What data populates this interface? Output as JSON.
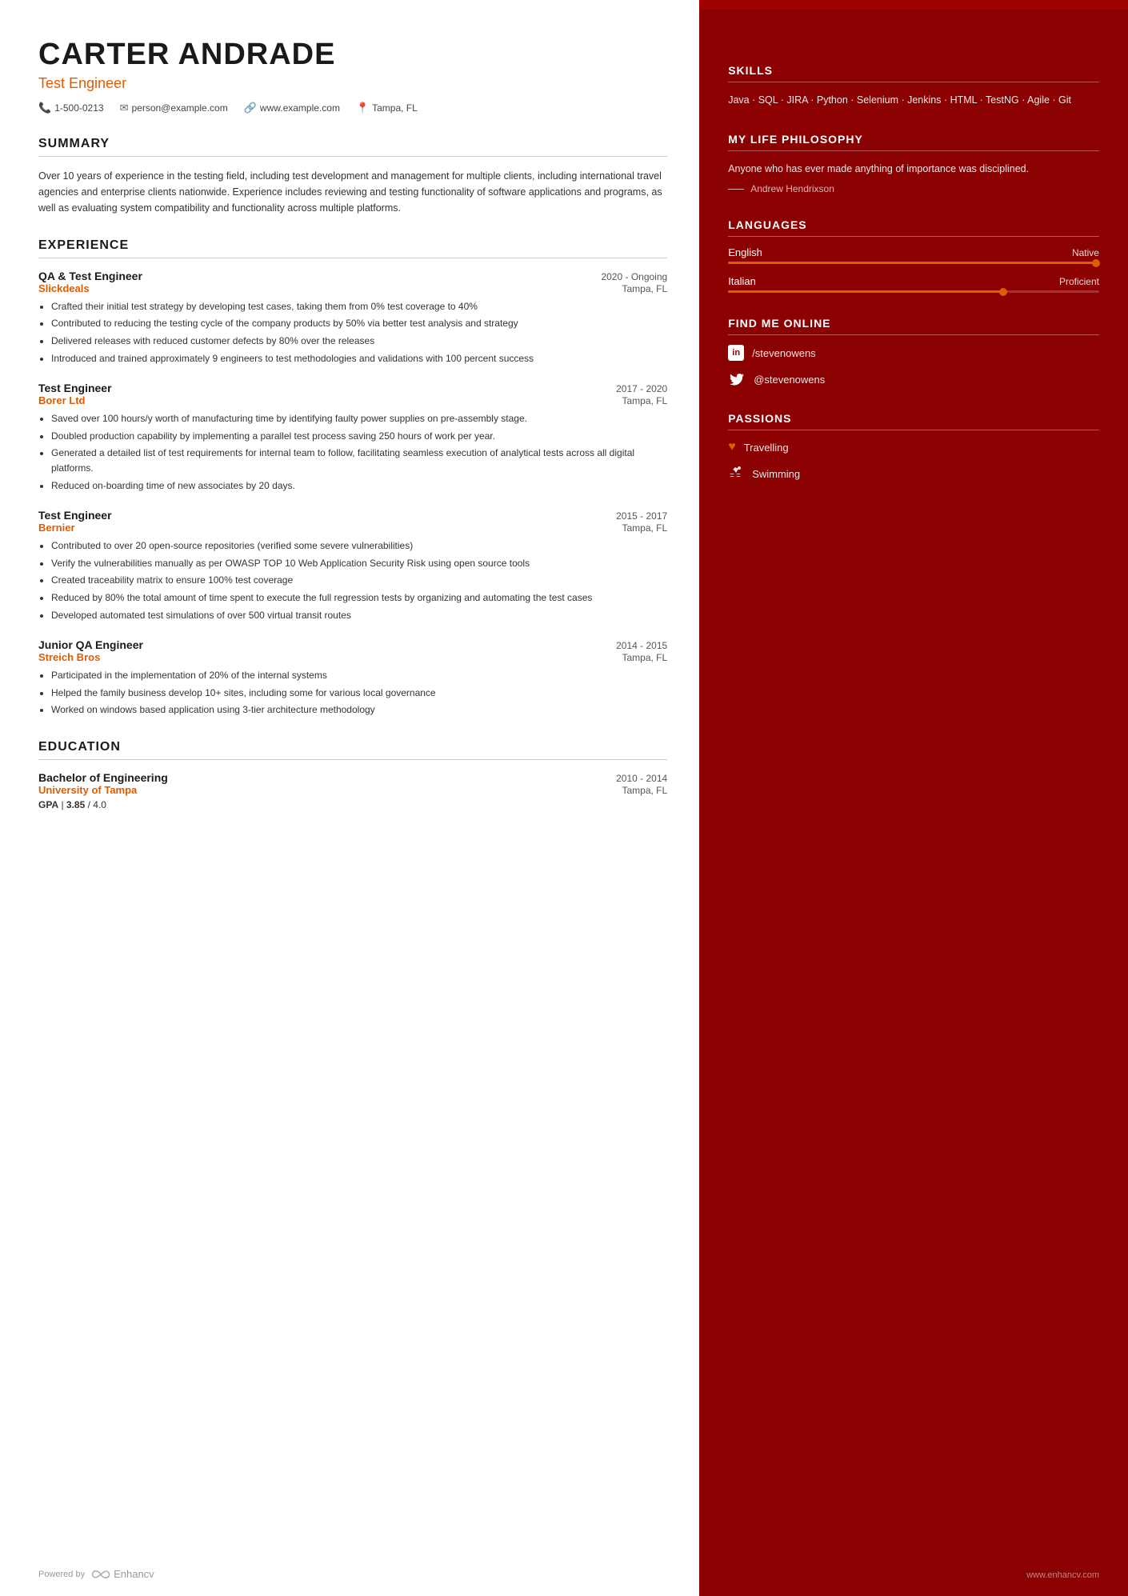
{
  "header": {
    "name": "CARTER ANDRADE",
    "title": "Test Engineer",
    "phone": "1-500-0213",
    "email": "person@example.com",
    "website": "www.example.com",
    "location": "Tampa, FL"
  },
  "summary": {
    "section_title": "SUMMARY",
    "text": "Over 10 years of experience in the testing field, including test development and management for multiple clients, including international travel agencies and enterprise clients nationwide. Experience includes reviewing and testing functionality of software applications and programs, as well as evaluating system compatibility and functionality across multiple platforms."
  },
  "experience": {
    "section_title": "EXPERIENCE",
    "jobs": [
      {
        "role": "QA & Test Engineer",
        "date": "2020 - Ongoing",
        "company": "Slickdeals",
        "location": "Tampa, FL",
        "bullets": [
          "Crafted their initial test strategy by developing test cases, taking them from 0% test coverage to 40%",
          "Contributed to reducing the testing cycle of the company products by 50% via better test analysis and strategy",
          "Delivered releases with reduced customer defects by 80% over the releases",
          "Introduced and trained approximately 9 engineers to test methodologies and validations with 100 percent success"
        ]
      },
      {
        "role": "Test Engineer",
        "date": "2017 - 2020",
        "company": "Borer Ltd",
        "location": "Tampa, FL",
        "bullets": [
          "Saved over 100 hours/y worth of manufacturing time by identifying faulty power supplies on pre-assembly stage.",
          "Doubled production capability by implementing a parallel test process saving 250 hours of work per year.",
          "Generated a detailed list of test requirements for internal team to follow, facilitating seamless execution of analytical tests across all digital platforms.",
          "Reduced on-boarding time of new associates by 20 days."
        ]
      },
      {
        "role": "Test Engineer",
        "date": "2015 - 2017",
        "company": "Bernier",
        "location": "Tampa, FL",
        "bullets": [
          "Contributed to over 20 open-source repositories (verified some severe vulnerabilities)",
          "Verify the vulnerabilities manually as per OWASP TOP 10 Web Application Security Risk using open source tools",
          "Created traceability matrix to ensure 100% test coverage",
          "Reduced by 80% the total amount of time spent to execute the full regression tests by organizing and automating the test cases",
          "Developed automated test simulations of over 500 virtual transit routes"
        ]
      },
      {
        "role": "Junior QA Engineer",
        "date": "2014 - 2015",
        "company": "Streich Bros",
        "location": "Tampa, FL",
        "bullets": [
          "Participated in the implementation of 20% of the internal systems",
          "Helped the family business develop 10+ sites, including some for various local governance",
          "Worked on windows based application using 3-tier architecture methodology"
        ]
      }
    ]
  },
  "education": {
    "section_title": "EDUCATION",
    "items": [
      {
        "degree": "Bachelor of Engineering",
        "date": "2010 - 2014",
        "school": "University of Tampa",
        "location": "Tampa, FL",
        "gpa_label": "GPA",
        "gpa_value": "3.85",
        "gpa_max": "4.0"
      }
    ]
  },
  "skills": {
    "section_title": "SKILLS",
    "text": "Java · SQL · JIRA · Python · Selenium · Jenkins · HTML · TestNG · Agile · Git"
  },
  "philosophy": {
    "section_title": "MY LIFE PHILOSOPHY",
    "quote": "Anyone who has ever made anything of importance was disciplined.",
    "author": "Andrew Hendrixson"
  },
  "languages": {
    "section_title": "LANGUAGES",
    "items": [
      {
        "name": "English",
        "level": "Native",
        "fill_percent": 100
      },
      {
        "name": "Italian",
        "level": "Proficient",
        "fill_percent": 75
      }
    ]
  },
  "online": {
    "section_title": "FIND ME ONLINE",
    "items": [
      {
        "platform": "LinkedIn",
        "icon": "in",
        "handle": "/stevenowens"
      },
      {
        "platform": "Twitter",
        "icon": "🐦",
        "handle": "@stevenowens"
      }
    ]
  },
  "passions": {
    "section_title": "PASSIONS",
    "items": [
      {
        "name": "Travelling",
        "icon": "♥"
      },
      {
        "name": "Swimming",
        "icon": "🏊"
      }
    ]
  },
  "footer": {
    "powered_by": "Powered by",
    "brand": "Enhancv",
    "website": "www.enhancv.com"
  },
  "colors": {
    "accent": "#e05c00",
    "dark_red": "#8b0000",
    "name_color": "#1a1a1a"
  }
}
